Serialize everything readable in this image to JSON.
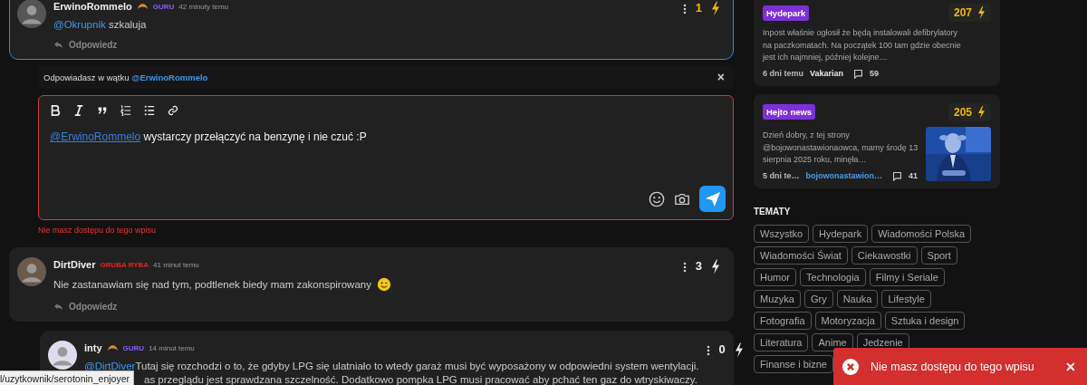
{
  "thread": {
    "comments": [
      {
        "author": "ErwinoRommelo",
        "croissant": true,
        "rank": {
          "label": "GURU",
          "color": "#8b5cf6"
        },
        "time": "42 minuty temu",
        "mention": "@Okrupnik",
        "text": "szkaluja",
        "emoji": false,
        "votes": "1",
        "voted": true,
        "highlighted": true,
        "nested": false,
        "reply_label": "Odpowiedz"
      }
    ],
    "reply": {
      "prefix": "Odpowiadasz w wątku",
      "mention": "@ErwinoRommelo",
      "close": "×",
      "editor_mention": "@ErwinoRommelo",
      "editor_text": "wystarczy przełączyć na benzynę i nie czuć :P",
      "error": true,
      "error_text": "Nie masz dostępu do tego wpisu"
    },
    "more_comments": [
      {
        "author": "DirtDiver",
        "croissant": false,
        "rank": {
          "label": "GRUBA RYBA",
          "color": "#e02424"
        },
        "time": "41 minut temu",
        "text": "Nie zastanawiam się nad tym, podtlenek biedy mam zakonspirowany",
        "emoji": true,
        "votes": "3",
        "voted": false,
        "highlighted": false,
        "nested": false,
        "reply_label": "Odpowiedz"
      },
      {
        "author": "inty",
        "croissant": true,
        "rank": {
          "label": "GURU",
          "color": "#8b5cf6"
        },
        "time": "14 minut temu",
        "mention": "@DirtDiver",
        "text": "Tutaj się rozchodzi o to, że gdyby LPG się ulatniało to wtedy garaż musi być wyposażony w odpowiedni system wentylacji.",
        "continuation": "as przeglądu jest sprawdzana szczelność. Dodatkowo pompka LPG musi pracować aby pchać ten gaz do wtryskiwaczy.",
        "emoji": false,
        "votes": "0",
        "voted": false,
        "highlighted": false,
        "nested": true
      }
    ]
  },
  "sidebar": {
    "posts": [
      {
        "tag": "Hydepark",
        "score": "207",
        "excerpt": "Inpost właśnie ogłosił że będą instalowali defibrylatory na paczkomatach. Na początek 100 tam gdzie obecnie jest ich najmniej, później kolejne…",
        "time": "6 dni temu",
        "author": "Vakarian",
        "author_link": false,
        "comments": "59",
        "kind": "text"
      },
      {
        "tag": "Hejto news",
        "score": "205",
        "excerpt": "Dzień dobry, z tej strony @bojowonastawionaowca, mamy środę 13 sierpnia 2025 roku, minęła…",
        "time": "5 dni te…",
        "author": "bojowonastawion…",
        "author_link": true,
        "comments": "41",
        "kind": "picture"
      }
    ],
    "topics_title": "TEMATY",
    "topics": [
      "Wszystko",
      "Hydepark",
      "Wiadomości Polska",
      "Wiadomości Świat",
      "Ciekawostki",
      "Sport",
      "Humor",
      "Technologia",
      "Filmy i Seriale",
      "Muzyka",
      "Gry",
      "Nauka",
      "Lifestyle",
      "Fotografia",
      "Motoryzacja",
      "Sztuka i design",
      "Literatura",
      "Anime",
      "Jedzenie",
      "Finanse i bizne"
    ]
  },
  "toast": {
    "text": "Nie masz dostępu do tego wpisu",
    "close": "✕"
  },
  "status_link": "l/uzytkownik/serotonin_enjoyer"
}
